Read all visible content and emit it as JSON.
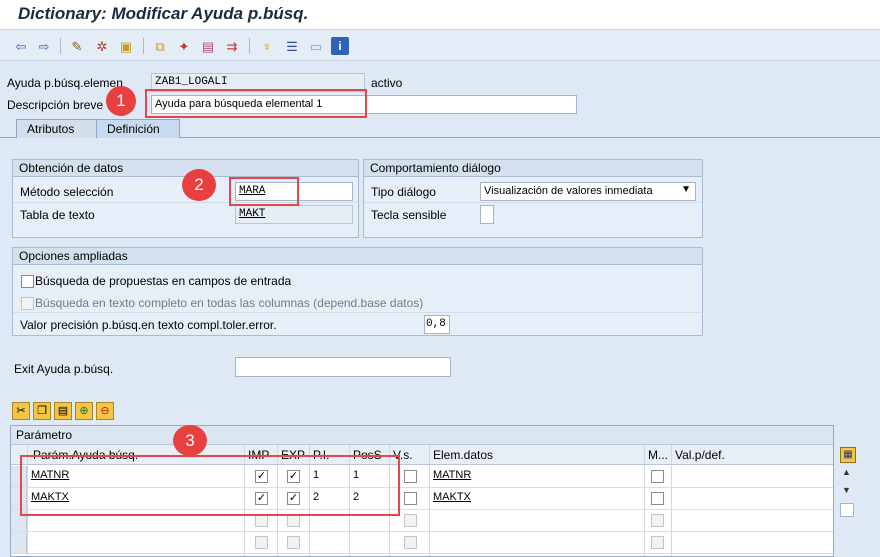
{
  "window": {
    "title": "Dictionary: Modificar Ayuda p.búsq."
  },
  "toolbar": {
    "icons": [
      "back-icon",
      "forward-icon",
      "display-change-icon",
      "active-inactive-icon",
      "object-list-icon",
      "other-object-icon",
      "where-used-icon",
      "activate-icon",
      "graphic-icon",
      "navigate-icon",
      "hierarchy-icon",
      "append-icon",
      "window-icon",
      "info-icon"
    ]
  },
  "header": {
    "search_help_label": "Ayuda p.búsq.elemen",
    "search_help_value": "ZAB1_LOGALI",
    "status": "activo",
    "short_desc_label": "Descripción breve",
    "short_desc_value": "Ayuda para búsqueda elemental 1"
  },
  "tabs": [
    {
      "label": "Atributos",
      "active": false
    },
    {
      "label": "Definición",
      "active": true
    }
  ],
  "data_collection": {
    "title": "Obtención de datos",
    "selection_method_label": "Método selección",
    "selection_method_value": "MARA",
    "text_table_label": "Tabla de texto",
    "text_table_value": "MAKT"
  },
  "dialog_behavior": {
    "title": "Comportamiento diálogo",
    "dialog_type_label": "Tipo diálogo",
    "dialog_type_value": "Visualización de valores inmediata",
    "hot_key_label": "Tecla sensible",
    "hot_key_value": ""
  },
  "extended_options": {
    "title": "Opciones ampliadas",
    "proposal_search_label": "Búsqueda de propuestas en campos de entrada",
    "fulltext_search_label": "Búsqueda en texto completo en todas las columnas (depend.base datos)",
    "accuracy_label": "Valor precisión p.búsq.en texto compl.toler.error.",
    "accuracy_value": "0,8"
  },
  "exit": {
    "label": "Exit Ayuda p.búsq.",
    "value": ""
  },
  "params_table": {
    "group_title": "Parámetro",
    "columns": [
      "Parám.Ayuda búsq.",
      "IMP",
      "EXP",
      "P.I.",
      "PosS",
      "V.s.",
      "Elem.datos",
      "M...",
      "Val.p/def."
    ],
    "rows": [
      {
        "param": "MATNR",
        "imp": true,
        "exp": true,
        "pi": "1",
        "poss": "1",
        "vs": false,
        "elem": "MATNR",
        "m": false,
        "def": ""
      },
      {
        "param": "MAKTX",
        "imp": true,
        "exp": true,
        "pi": "2",
        "poss": "2",
        "vs": false,
        "elem": "MAKTX",
        "m": false,
        "def": ""
      }
    ]
  },
  "annotations": {
    "marker1": "1",
    "marker2": "2",
    "marker3": "3"
  },
  "colors": {
    "accent_red": "#e3474c",
    "marker_red": "#e8403f"
  }
}
